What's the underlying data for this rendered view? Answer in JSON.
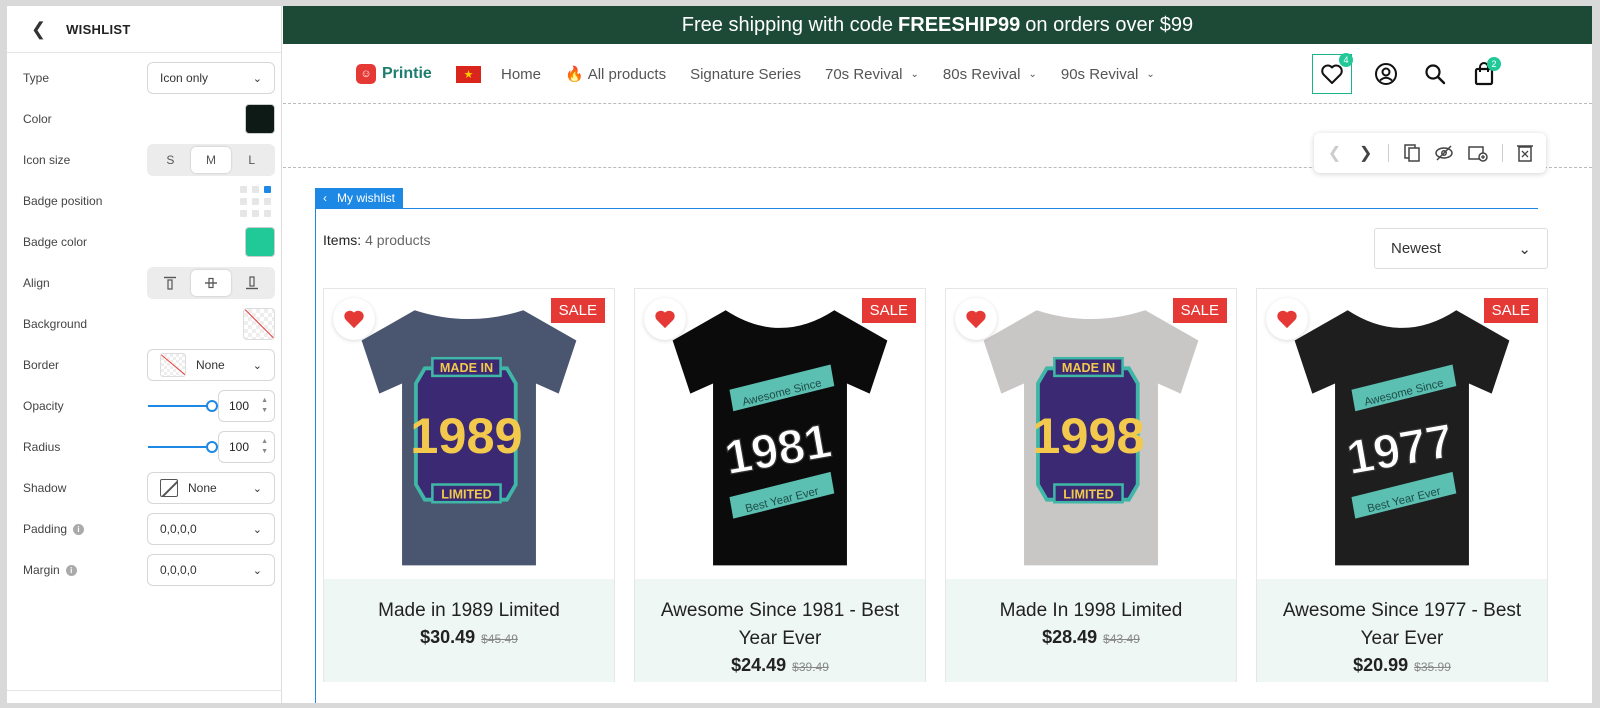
{
  "panel": {
    "title": "WISHLIST",
    "type": {
      "label": "Type",
      "value": "Icon only"
    },
    "color": {
      "label": "Color",
      "value": "#0d1a16"
    },
    "icon_size": {
      "label": "Icon size",
      "options": [
        "S",
        "M",
        "L"
      ],
      "selected": "M"
    },
    "badge_position": {
      "label": "Badge position"
    },
    "badge_color": {
      "label": "Badge color",
      "value": "#20c997"
    },
    "align": {
      "label": "Align"
    },
    "background": {
      "label": "Background"
    },
    "border": {
      "label": "Border",
      "value": "None"
    },
    "opacity": {
      "label": "Opacity",
      "value": "100"
    },
    "radius": {
      "label": "Radius",
      "value": "100"
    },
    "shadow": {
      "label": "Shadow",
      "value": "None"
    },
    "padding": {
      "label": "Padding",
      "value": "0,0,0,0"
    },
    "margin": {
      "label": "Margin",
      "value": "0,0,0,0"
    }
  },
  "promo": {
    "prefix": "Free shipping with code",
    "code": "FREESHIP99",
    "suffix": "on orders over $99"
  },
  "header": {
    "logo": "Printie",
    "menu": [
      "Home",
      "All products",
      "Signature Series",
      "70s Revival",
      "80s Revival",
      "90s Revival"
    ],
    "wishlist_count": "4",
    "cart_count": "2"
  },
  "wishlist": {
    "tag": "My wishlist",
    "items_label": "Items:",
    "items_count": "4 products",
    "sort": "Newest",
    "sale_label": "SALE",
    "products": [
      {
        "name": "Made in 1989 Limited",
        "price": "$30.49",
        "old": "$45.49",
        "year": "1989",
        "shirt": "#4a5670",
        "style": "made"
      },
      {
        "name": "Awesome Since 1981 - Best Year Ever",
        "price": "$24.49",
        "old": "$39.49",
        "year": "1981",
        "shirt": "#0b0b0b",
        "style": "awesome"
      },
      {
        "name": "Made In 1998 Limited",
        "price": "$28.49",
        "old": "$43.49",
        "year": "1998",
        "shirt": "#c9c6c6",
        "style": "made"
      },
      {
        "name": "Awesome Since 1977 - Best Year Ever",
        "price": "$20.99",
        "old": "$35.99",
        "year": "1977",
        "shirt": "#1e1e1e",
        "style": "awesome"
      }
    ]
  },
  "colors": {
    "accent": "#1e88e5",
    "promo_bg": "#1c4a36",
    "sale": "#e53935",
    "heart": "#e53935",
    "badge": "#20c997"
  }
}
